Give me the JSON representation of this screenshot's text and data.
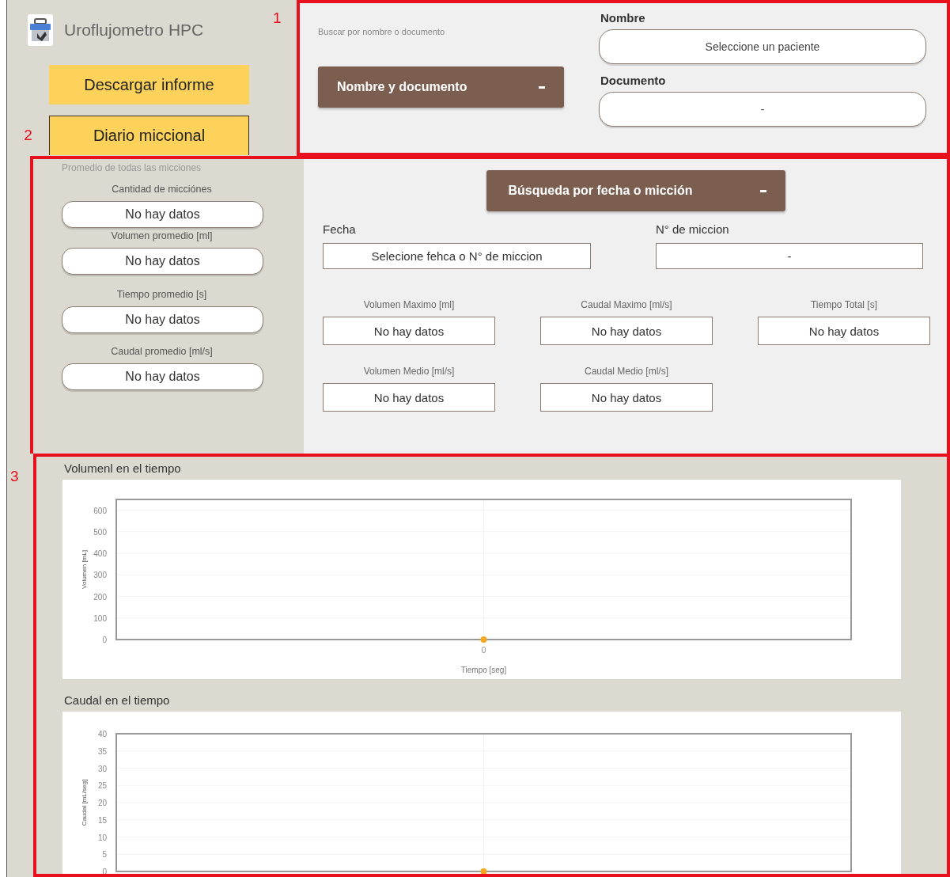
{
  "header": {
    "title": "Uroflujometro HPC"
  },
  "nav": [
    {
      "label": "Descargar informe",
      "selected": false
    },
    {
      "label": "Diario miccional",
      "selected": true
    }
  ],
  "patient_search": {
    "annotation": "1",
    "hint": "Buscar por nombre o documento",
    "dropdown": "Nombre y documento",
    "fields": [
      {
        "label": "Nombre",
        "value": "Seleccione un paciente"
      },
      {
        "label": "Documento",
        "value": "-"
      }
    ]
  },
  "summary": {
    "annotation": "2",
    "averages": {
      "title": "Promedio de  todas las micciones",
      "fields": [
        {
          "label": "Cantidad de micciónes",
          "value": "No hay datos"
        },
        {
          "label": "Volumen promedio [ml]",
          "value": "No hay datos"
        },
        {
          "label": "Tiempo promedio [s]",
          "value": "No hay datos"
        },
        {
          "label": "Caudal promedio [ml/s]",
          "value": "No hay datos"
        }
      ]
    },
    "search": {
      "dropdown": "Búsqueda por fecha o micción",
      "selectors": [
        {
          "label": "Fecha",
          "value": "Selecione fehca o N° de miccion"
        },
        {
          "label": "N° de miccion",
          "value": "-"
        }
      ],
      "metrics": [
        {
          "label": "Volumen Maximo [ml]",
          "value": "No hay datos"
        },
        {
          "label": "Caudal Maximo [ml/s]",
          "value": "No hay datos"
        },
        {
          "label": "Tiempo Total [s]",
          "value": "No hay datos"
        },
        {
          "label": "Volumen Medio [ml/s]",
          "value": "No hay datos"
        },
        {
          "label": "Caudal Medio [ml/s]",
          "value": "No hay datos"
        }
      ]
    }
  },
  "charts_section": {
    "annotation": "3",
    "charts": [
      {
        "title": "Volumenl en el tiempo",
        "chart_data": {
          "type": "line",
          "xlabel": "Tiempo [seg]",
          "ylabel": "Volumen [mL]",
          "categories": [
            null
          ],
          "grid": true,
          "series": [
            {
              "color": "#f5a623",
              "marker": "circle",
              "values": [
                0
              ]
            }
          ],
          "ylim": [
            0,
            650
          ],
          "yticks": [
            0,
            100,
            200,
            300,
            400,
            500,
            600
          ],
          "annotations": [
            {
              "text": "0"
            }
          ]
        }
      },
      {
        "title": "Caudal en el tiempo",
        "chart_data": {
          "type": "line",
          "ylabel": "Caudal [mL/seg]",
          "categories": [
            null
          ],
          "grid": true,
          "series": [
            {
              "color": "#f5a623",
              "marker": "circle",
              "values": [
                0
              ]
            }
          ],
          "ylim": [
            0,
            40
          ],
          "yticks": [
            0,
            5,
            10,
            15,
            20,
            25,
            30,
            35,
            40
          ]
        }
      }
    ]
  }
}
